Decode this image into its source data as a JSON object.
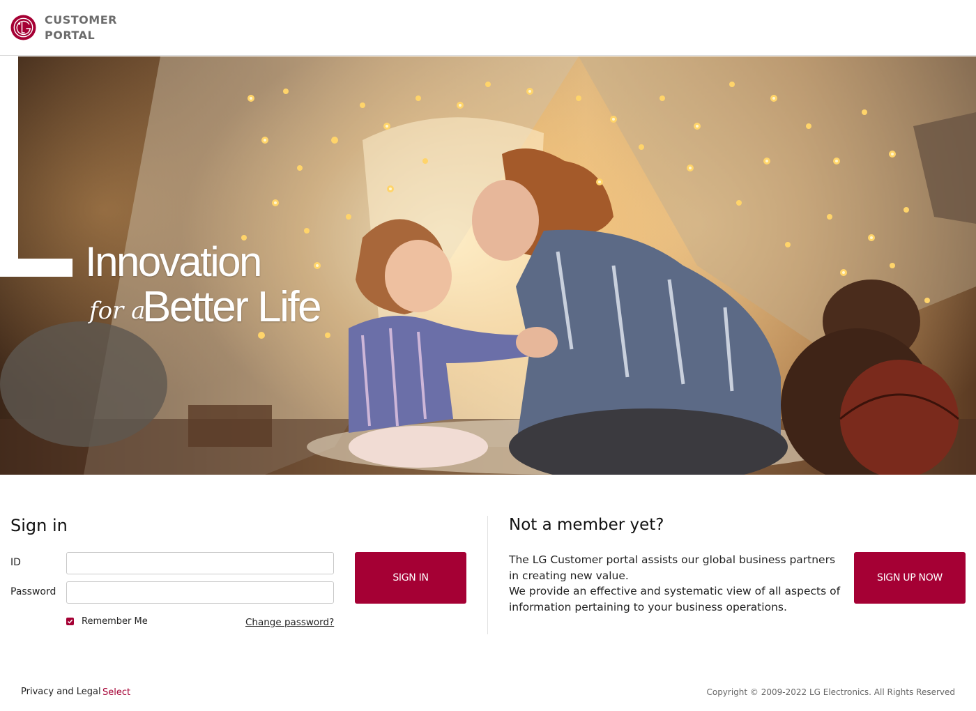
{
  "header": {
    "logo_text": "LG",
    "portal_line1": "CUSTOMER",
    "portal_line2": "PORTAL",
    "brand_color": "#a50034"
  },
  "hero": {
    "tagline_line1": "Innovation",
    "tagline_for_a": "for a",
    "tagline_line2": "Better Life"
  },
  "signin": {
    "title": "Sign in",
    "id_label": "ID",
    "id_value": "",
    "password_label": "Password",
    "password_value": "",
    "remember_label": "Remember Me",
    "remember_checked": true,
    "change_password_link": "Change password?",
    "submit_label": "SIGN IN"
  },
  "signup": {
    "title": "Not a member yet?",
    "description_line1": "The LG Customer portal assists our global business partners in creating new value.",
    "description_line2": "We provide an effective and systematic view of all aspects of information pertaining to your business operations.",
    "button_label": "SIGN UP NOW"
  },
  "footer": {
    "privacy_label": "Privacy and Legal",
    "select_label": "Select",
    "copyright": "Copyright © 2009-2022 LG Electronics. All Rights Reserved"
  }
}
